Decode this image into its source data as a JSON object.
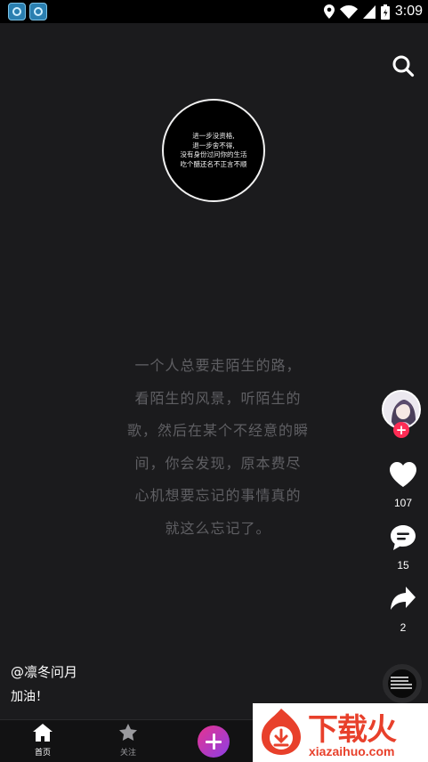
{
  "status_bar": {
    "time": "3:09"
  },
  "disc": {
    "lines": [
      "进一步没资格,",
      "退一步舍不得,",
      "没有身份过问你的生活",
      "吃个醋还名不正言不顺"
    ]
  },
  "poem": {
    "lines": [
      "一个人总要走陌生的路，",
      "看陌生的风景，听陌生的",
      "歌，然后在某个不经意的瞬",
      "间，你会发现，原本费尽",
      "心机想要忘记的事情真的",
      "就这么忘记了。"
    ]
  },
  "rail": {
    "like_count": "107",
    "comment_count": "15",
    "share_count": "2",
    "follow_symbol": "+"
  },
  "post": {
    "username": "@凛冬问月",
    "caption": "加油！"
  },
  "mini_disc": {
    "lines": [
      "进一步没资格,",
      "退一步舍不得,",
      "没有身份过问你的生活",
      "吃个醋还名不正言不顺"
    ]
  },
  "tabbar": {
    "home_label": "首页",
    "follow_label": "关注"
  },
  "watermark": {
    "title": "下载火",
    "url": "xiazaihuo.com"
  },
  "colors": {
    "accent_pink": "#fe2c55",
    "watermark_red": "#e8402b",
    "background": "#1c1c1e"
  },
  "icons": [
    "app-icon",
    "location-icon",
    "wifi-icon",
    "signal-icon",
    "battery-icon",
    "search-icon",
    "heart-icon",
    "comment-icon",
    "share-icon",
    "home-icon",
    "star-icon",
    "plus-icon"
  ]
}
